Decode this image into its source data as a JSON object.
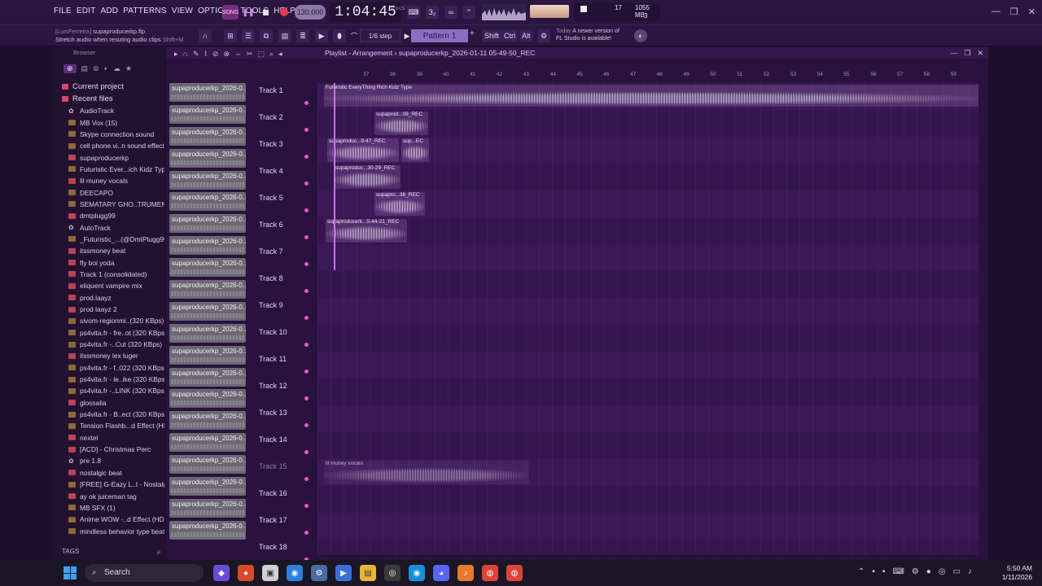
{
  "menu": [
    "FILE",
    "EDIT",
    "ADD",
    "PATTERNS",
    "VIEW",
    "OPTIONS",
    "TOOLS",
    "HELP"
  ],
  "transport": {
    "song_label": "SONG",
    "tempo": "130.000",
    "time": "1:04:45",
    "time_unit": "M:S:CS"
  },
  "cpu": {
    "value": "17",
    "memory": "1055 MB",
    "polyphony": "3"
  },
  "project": {
    "user": "[LuisFerreira]",
    "file": "supaproducerkp.flp",
    "hint": "Stretch audio when resizing audio clips",
    "hint_shortcut": "Shift+M"
  },
  "step": "1/6 step",
  "pattern": "Pattern 1",
  "keys": [
    "Shift",
    "Ctrl",
    "Alt"
  ],
  "news": {
    "today": "Today",
    "line1": "A newer version of",
    "line2": "FL Studio is available!"
  },
  "browser": {
    "title": "Browser",
    "folders": [
      "Current project",
      "Recent files"
    ],
    "files": [
      {
        "name": "AudioTrack",
        "type": "proj"
      },
      {
        "name": "MB Vox (15)",
        "type": "audio"
      },
      {
        "name": "Skype connection sound",
        "type": "audio"
      },
      {
        "name": "cell phone vi..n sound effect",
        "type": "audio"
      },
      {
        "name": "supaproducerkp",
        "type": "file"
      },
      {
        "name": "Futuristic Ever...ich Kidz Type",
        "type": "audio"
      },
      {
        "name": "lil muney vocals",
        "type": "file"
      },
      {
        "name": "DEECAPO",
        "type": "audio"
      },
      {
        "name": "SEMATARY GHO..TRUMENTAL",
        "type": "audio"
      },
      {
        "name": "dmtplugg99",
        "type": "file"
      },
      {
        "name": "AutoTrack",
        "type": "proj"
      },
      {
        "name": "_Futuristic_...(@DmtPlugg99)",
        "type": "audio"
      },
      {
        "name": "itssmoney beat",
        "type": "file"
      },
      {
        "name": "fly boi yoda",
        "type": "file"
      },
      {
        "name": "Track 1 (consolidated)",
        "type": "file"
      },
      {
        "name": "eliquent vampire mix",
        "type": "file"
      },
      {
        "name": "prod.laayz",
        "type": "file"
      },
      {
        "name": "prod laayz 2",
        "type": "file"
      },
      {
        "name": "sivom-regionmi..(320 KBps)",
        "type": "audio"
      },
      {
        "name": "ps4vita.fr - fre..ot (320 KBps)",
        "type": "audio"
      },
      {
        "name": "ps4vita.fr -..Cut (320 KBps)",
        "type": "audio"
      },
      {
        "name": "itssmoney lex luger",
        "type": "file"
      },
      {
        "name": "ps4vita.fr - f..022 (320 KBps)",
        "type": "audio"
      },
      {
        "name": "ps4vita.fr - le..ike (320 KBps)",
        "type": "audio"
      },
      {
        "name": "ps4vita.fr -..LINK (320 KBps)",
        "type": "audio"
      },
      {
        "name": "glossalia",
        "type": "file"
      },
      {
        "name": "ps4vita.fr - B..ect (320 KBps)",
        "type": "audio"
      },
      {
        "name": "Tension Flashb...d Effect (HD)",
        "type": "audio"
      },
      {
        "name": "nextel",
        "type": "file"
      },
      {
        "name": "[ACD] - Christmas Perc",
        "type": "file"
      },
      {
        "name": "pre 1.8",
        "type": "proj"
      },
      {
        "name": "nostalgic beat",
        "type": "file"
      },
      {
        "name": "[FREE] G-Eazy L..t - Nostalgic",
        "type": "audio"
      },
      {
        "name": "ay ok juiceman tag",
        "type": "file"
      },
      {
        "name": "MB SFX (1)",
        "type": "audio"
      },
      {
        "name": "Anime WOW -..d Effect (HD)",
        "type": "audio"
      },
      {
        "name": "mindless behavior type beat",
        "type": "audio"
      }
    ],
    "tags_label": "TAGS"
  },
  "playlist": {
    "title": "Playlist - Arrangement",
    "session": "supaproducerkp_2026-01-11 05-49-50_REC",
    "pattern_clips": [
      "supaproducerkp_2026-0...",
      "supaproducerkp_2026-0...",
      "supaproducerkp_2026-0...",
      "supaproducerkp_2026-0...",
      "supaproducerkp_2026-0...",
      "supaproducerkp_2026-0...",
      "supaproducerkp_2026-0...",
      "supaproducerkp_2026-0...",
      "supaproducerkp_2026-0...",
      "supaproducerkp_2026-0...",
      "supaproducerkp_2026-0...",
      "supaproducerkp_2026-0...",
      "supaproducerkp_2026-0...",
      "supaproducerkp_2026-0...",
      "supaproducerkp_2026-0...",
      "supaproducerkp_2026-0...",
      "supaproducerkp_2026-0...",
      "supaproducerkp_2026-0...",
      "supaproducerkp_2026-0...",
      "supaproducerkp_2026-0...",
      "supaproducerkp_2026-0..."
    ],
    "tracks": [
      "Track 1",
      "Track 2",
      "Track 3",
      "Track 4",
      "Track 5",
      "Track 6",
      "Track 7",
      "Track 8",
      "Track 9",
      "Track 10",
      "Track 11",
      "Track 12",
      "Track 13",
      "Track 14",
      "Track 15",
      "Track 16",
      "Track 17",
      "Track 18"
    ],
    "ruler": [
      "37",
      "38",
      "39",
      "40",
      "41",
      "42",
      "43",
      "44",
      "45",
      "46",
      "47",
      "48",
      "49",
      "50",
      "51",
      "52",
      "53",
      "54",
      "55",
      "56",
      "57",
      "58",
      "59"
    ],
    "clips": [
      {
        "label": "Futuristic EveryThing Rich Kidz Type"
      },
      {
        "label": "supaprod...08_REC"
      },
      {
        "label": "supaproduc...9-47_REC"
      },
      {
        "label": "sup...EC"
      },
      {
        "label": "supaproduc...30-29_REC"
      },
      {
        "label": "supapro...36_REC"
      },
      {
        "label": "supaproducerk...5-44-21_REC"
      },
      {
        "label": "lil muney vocals"
      }
    ]
  },
  "taskbar": {
    "search": "Search",
    "time": "5:50 AM",
    "date": "1/11/2026"
  }
}
